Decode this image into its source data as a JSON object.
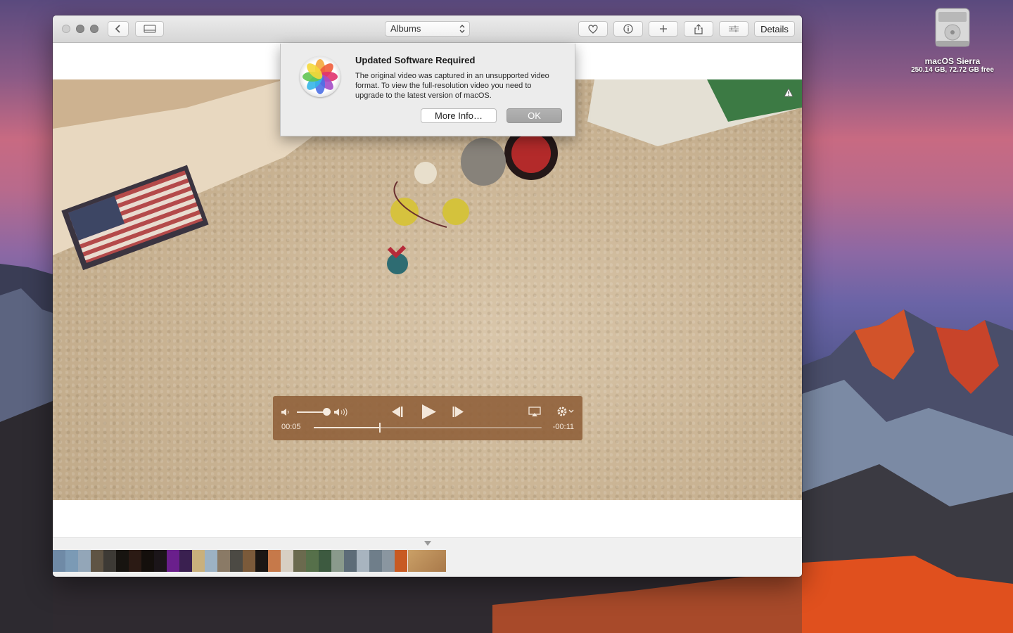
{
  "toolbar": {
    "albums_label": "Albums",
    "details_label": "Details"
  },
  "dialog": {
    "title": "Updated Software Required",
    "message": "The original video was captured in an unsupported video format. To view the full-resolution video you need to upgrade to the latest version of macOS.",
    "more_info_label": "More Info…",
    "ok_label": "OK"
  },
  "player": {
    "current_time": "00:05",
    "remaining_time": "-00:11",
    "progress_fraction": 0.29,
    "volume_fraction": 0.9
  },
  "desktop": {
    "drive_name": "macOS Sierra",
    "drive_info": "250.14 GB, 72.72 GB free"
  },
  "filmstrip": {
    "thumb_colors": [
      "#6f8aa6",
      "#7b9ab5",
      "#93a6b8",
      "#5f5444",
      "#3d3a35",
      "#171410",
      "#2b1a14",
      "#140f0c",
      "#1b1519",
      "#6a1f8c",
      "#3a2050",
      "#c9b07c",
      "#9cb2c4",
      "#8a7a66",
      "#4c4a44",
      "#7b5a3a",
      "#1a1614",
      "#c6794a",
      "#d7cfc3",
      "#6b6a4e",
      "#56704a",
      "#3d5a40",
      "#8a9a8c",
      "#5d6c78",
      "#a8b4bf",
      "#6f7e8a",
      "#8a96a0",
      "#c85a22"
    ]
  }
}
